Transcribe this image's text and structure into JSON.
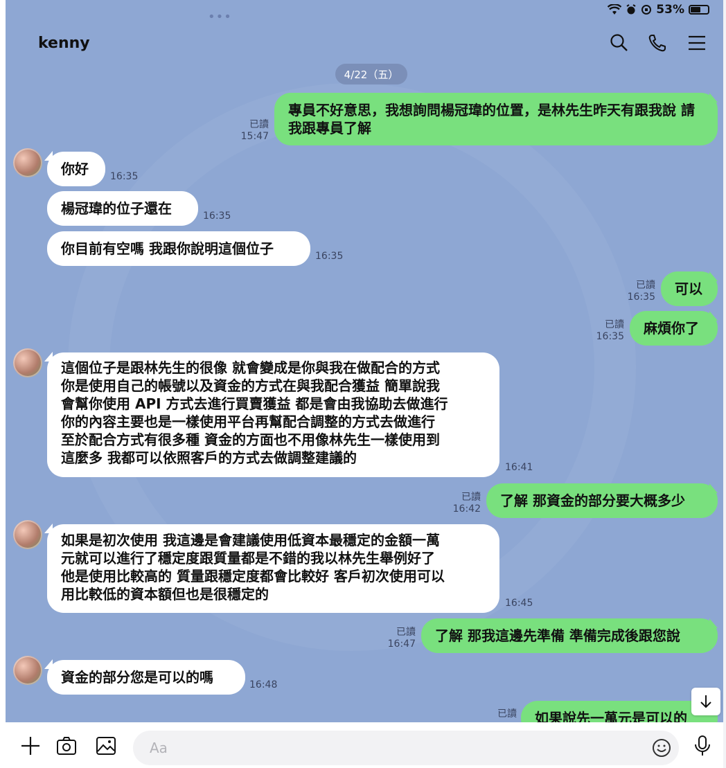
{
  "status": {
    "battery": "53%",
    "battery_level": 0.53
  },
  "header": {
    "title": "kenny"
  },
  "date_divider": "4/22（五）",
  "messages": [
    {
      "text": "專員不好意思，我想詢問楊冠瑋的位置，是林先生昨天有跟我說 請我跟專員了解",
      "read": "已讀",
      "time": "15:47"
    },
    {
      "text": "你好",
      "time": "16:35"
    },
    {
      "text": "楊冠瑋的位子還在",
      "time": "16:35"
    },
    {
      "text": "你目前有空嗎 我跟你說明這個位子",
      "time": "16:35"
    },
    {
      "text": "可以",
      "read": "已讀",
      "time": "16:35"
    },
    {
      "text": "麻煩你了",
      "read": "已讀",
      "time": "16:35"
    },
    {
      "lines": [
        "這個位子是跟林先生的很像 就會變成是你與我在做配合的方式",
        "你是使用自己的帳號以及資金的方式在與我配合獲益  簡單說我",
        "會幫你使用 API 方式去進行買賣獲益 都是會由我協助去做進行",
        "你的內容主要也是一樣使用平台再幫配合調整的方式去做進行",
        "至於配合方式有很多種 資金的方面也不用像林先生一樣使用到",
        "這麼多 我都可以依照客戶的方式去做調整建議的"
      ],
      "time": "16:41"
    },
    {
      "text": "了解 那資金的部分要大概多少",
      "read": "已讀",
      "time": "16:42"
    },
    {
      "lines": [
        "如果是初次使用 我這邊是會建議使用低資本最穩定的金額一萬",
        "元就可以進行了穩定度跟質量都是不錯的我以林先生舉例好了",
        "他是使用比較高的 質量跟穩定度都會比較好 客戶初次使用可以",
        "用比較低的資本額但也是很穩定的"
      ],
      "time": "16:45"
    },
    {
      "text": "了解 那我這邊先準備 準備完成後跟您說",
      "read": "已讀",
      "time": "16:47"
    },
    {
      "text": "資金的部分您是可以的嗎",
      "time": "16:48"
    },
    {
      "text": "如果說先一萬元是可以的",
      "read": "已讀"
    }
  ],
  "composer": {
    "placeholder": "Aa"
  },
  "icons": {
    "header": [
      "search-icon",
      "phone-icon",
      "menu-icon"
    ],
    "composer": [
      "plus-icon",
      "camera-icon",
      "image-icon",
      "emoji-icon",
      "mic-icon"
    ],
    "scroll": "arrow-down-icon"
  },
  "colors": {
    "chat_bg": "#8ea7d3",
    "outgoing_bubble": "#79e07e",
    "incoming_bubble": "#ffffff"
  }
}
